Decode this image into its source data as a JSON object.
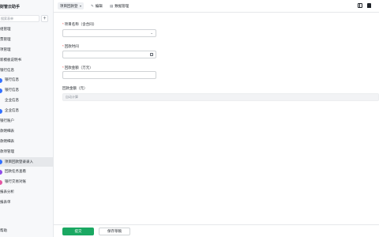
{
  "sidebar": {
    "title": "财管云助手",
    "search_placeholder": "搜索表单",
    "add_label": "+",
    "items": [
      {
        "label": "组管理",
        "style": "plain"
      },
      {
        "label": "票管理",
        "style": "plain"
      },
      {
        "label": "项管理",
        "style": "plain"
      },
      {
        "label": "新模板说明书",
        "style": "plain"
      },
      {
        "label": "银行信息",
        "style": "plain"
      },
      {
        "label": "银行信息",
        "style": "dot",
        "dot": "blue"
      },
      {
        "label": "银行信息",
        "style": "dot",
        "dot": "blue"
      },
      {
        "label": "企业信息",
        "style": "sub"
      },
      {
        "label": "企业信息",
        "style": "dot",
        "dot": "blue"
      },
      {
        "label": "银行账户",
        "style": "plain"
      },
      {
        "label": "款明细表",
        "style": "plain"
      },
      {
        "label": "款明细表",
        "style": "plain"
      },
      {
        "label": "款项管理",
        "style": "plain"
      },
      {
        "label": "项目回款登录录入",
        "style": "dot",
        "dot": "blue",
        "active": true
      },
      {
        "label": "回款任务查看",
        "style": "dot",
        "dot": "purple"
      },
      {
        "label": "银行交易对账",
        "style": "dot",
        "dot": "pink"
      },
      {
        "label": "报表分析",
        "style": "plain"
      },
      {
        "label": "报表单",
        "style": "plain"
      }
    ],
    "bottom_label": "帮助"
  },
  "topbar": {
    "tab_label": "项目回款登",
    "edit_label": "编辑",
    "data_label": "数据管理"
  },
  "form": {
    "field1_label": "项目名称（含合同）",
    "field1_required": "*",
    "field2_label": "回款时间",
    "field2_required": "*",
    "field3_label": "回款金额（万元）",
    "field3_required": "*",
    "field4_label": "回款金额（元）",
    "field4_placeholder": "自动计算"
  },
  "footer": {
    "submit_label": "提交",
    "save_label": "保存草稿"
  },
  "colors": {
    "accent_green": "#1aa862",
    "required_red": "#f54a45",
    "dot_blue": "#3370ff",
    "dot_purple": "#8f4de8",
    "dot_pink": "#e455a2"
  }
}
